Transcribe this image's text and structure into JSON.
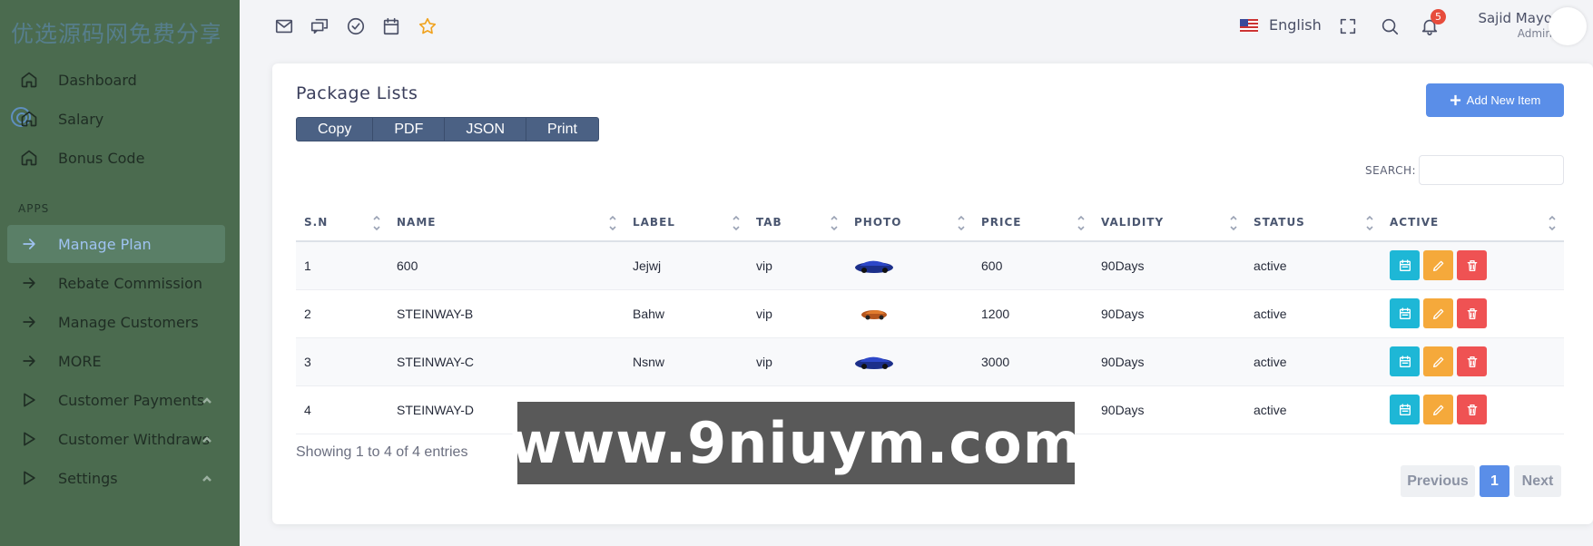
{
  "watermark_cn": "优选源码网免费分享",
  "sidebar": {
    "items": [
      {
        "label": "Dashboard"
      },
      {
        "label": "Salary"
      },
      {
        "label": "Bonus Code"
      }
    ],
    "section_label": "APPS",
    "apps": [
      {
        "label": "Manage Plan"
      },
      {
        "label": "Rebate Commission"
      },
      {
        "label": "Manage Customers"
      },
      {
        "label": "MORE"
      },
      {
        "label": "Customer Payments"
      },
      {
        "label": "Customer Withdraws"
      },
      {
        "label": "Settings"
      }
    ]
  },
  "topbar": {
    "language": "English",
    "notification_count": "5",
    "user_name": "Sajid Mayo",
    "user_role": "Admin"
  },
  "card": {
    "title": "Package Lists",
    "export_buttons": [
      "Copy",
      "PDF",
      "JSON",
      "Print"
    ],
    "add_button": "Add New Item",
    "search_label": "SEARCH:",
    "columns": [
      "S.N",
      "NAME",
      "LABEL",
      "TAB",
      "PHOTO",
      "PRICE",
      "VALIDITY",
      "STATUS",
      "ACTIVE"
    ],
    "rows": [
      {
        "sn": "1",
        "name": "600",
        "label": "Jejwj",
        "tab": "vip",
        "price": "600",
        "validity": "90Days",
        "status": "active",
        "car": "blue"
      },
      {
        "sn": "2",
        "name": "STEINWAY-B",
        "label": "Bahw",
        "tab": "vip",
        "price": "1200",
        "validity": "90Days",
        "status": "active",
        "car": "orange"
      },
      {
        "sn": "3",
        "name": "STEINWAY-C",
        "label": "Nsnw",
        "tab": "vip",
        "price": "3000",
        "validity": "90Days",
        "status": "active",
        "car": "blue"
      },
      {
        "sn": "4",
        "name": "STEINWAY-D",
        "label": "",
        "tab": "",
        "price": "",
        "validity": "90Days",
        "status": "active",
        "car": "none"
      }
    ],
    "info": "Showing 1 to 4 of 4 entries",
    "pager": {
      "previous": "Previous",
      "page": "1",
      "next": "Next"
    }
  },
  "overlay_text": "www.9niuym.com",
  "colors": {
    "sidebar": "#4b6b4f",
    "accent": "#5a8ee8",
    "export": "#4b6184"
  }
}
